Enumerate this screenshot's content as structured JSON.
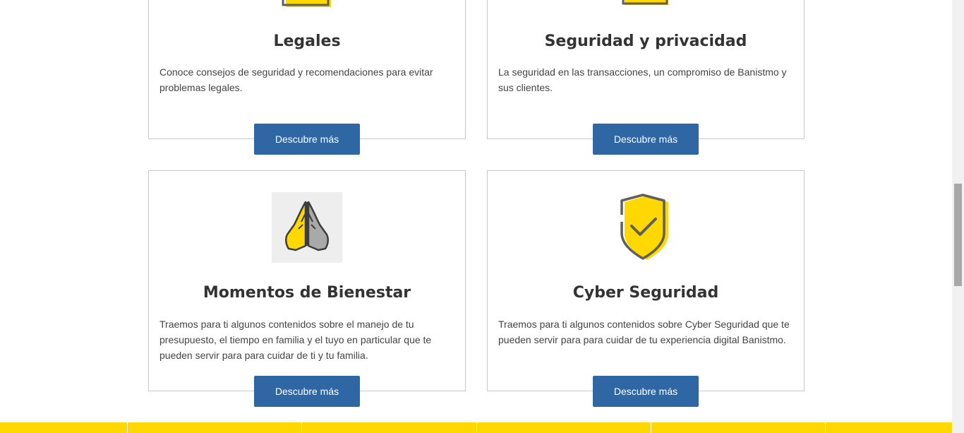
{
  "cards": [
    {
      "title": "Legales",
      "description": "Conoce consejos de seguridad y recomendaciones para evitar problemas legales.",
      "button_label": "Descubre más",
      "icon": "document-icon"
    },
    {
      "title": "Seguridad y privacidad",
      "description": "La seguridad en las transacciones, un compromiso de Banistmo y sus clientes.",
      "button_label": "Descubre más",
      "icon": "lock-icon"
    },
    {
      "title": "Momentos de Bienestar",
      "description": "Traemos para ti algunos contenidos sobre el manejo de tu presupuesto, el tiempo en familia y el tuyo en particular que te pueden servir para para cuidar de ti y tu familia.",
      "button_label": "Descubre más",
      "icon": "praying-hands-icon"
    },
    {
      "title": "Cyber Seguridad",
      "description": "Traemos para ti algunos contenidos sobre Cyber Seguridad que te pueden servir para para cuidar de tu experiencia digital Banistmo.",
      "button_label": "Descubre más",
      "icon": "shield-check-icon"
    }
  ],
  "colors": {
    "button": "#2f67a5",
    "accent_yellow": "#fed800",
    "border": "#c9c9c9",
    "icon_gray": "#6d6d6d"
  }
}
